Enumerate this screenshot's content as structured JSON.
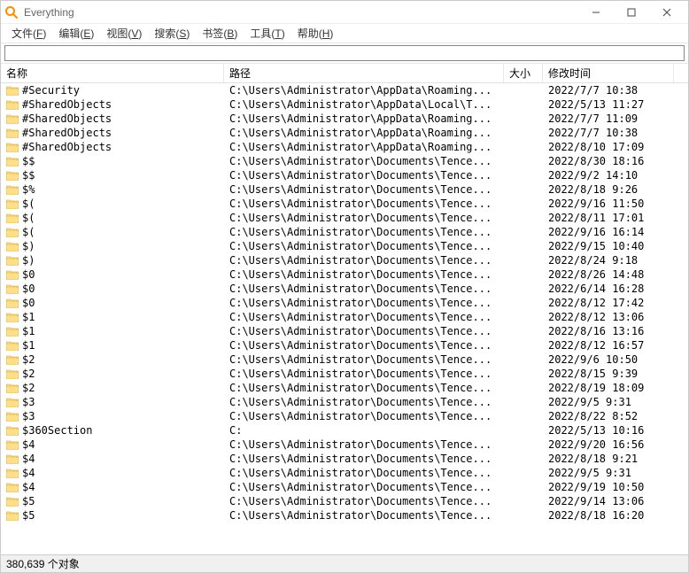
{
  "window": {
    "title": "Everything"
  },
  "menu": [
    {
      "label": "文件(F)",
      "key": "F"
    },
    {
      "label": "编辑(E)",
      "key": "E"
    },
    {
      "label": "视图(V)",
      "key": "V"
    },
    {
      "label": "搜索(S)",
      "key": "S"
    },
    {
      "label": "书签(B)",
      "key": "B"
    },
    {
      "label": "工具(T)",
      "key": "T"
    },
    {
      "label": "帮助(H)",
      "key": "H"
    }
  ],
  "search": {
    "value": "",
    "placeholder": ""
  },
  "columns": {
    "name": "名称",
    "path": "路径",
    "size": "大小",
    "modified": "修改时间"
  },
  "rows": [
    {
      "name": "#Security",
      "path": "C:\\Users\\Administrator\\AppData\\Roaming...",
      "size": "",
      "date": "2022/7/7 10:38"
    },
    {
      "name": "#SharedObjects",
      "path": "C:\\Users\\Administrator\\AppData\\Local\\T...",
      "size": "",
      "date": "2022/5/13 11:27"
    },
    {
      "name": "#SharedObjects",
      "path": "C:\\Users\\Administrator\\AppData\\Roaming...",
      "size": "",
      "date": "2022/7/7 11:09"
    },
    {
      "name": "#SharedObjects",
      "path": "C:\\Users\\Administrator\\AppData\\Roaming...",
      "size": "",
      "date": "2022/7/7 10:38"
    },
    {
      "name": "#SharedObjects",
      "path": "C:\\Users\\Administrator\\AppData\\Roaming...",
      "size": "",
      "date": "2022/8/10 17:09"
    },
    {
      "name": "$$",
      "path": "C:\\Users\\Administrator\\Documents\\Tence...",
      "size": "",
      "date": "2022/8/30 18:16"
    },
    {
      "name": "$$",
      "path": "C:\\Users\\Administrator\\Documents\\Tence...",
      "size": "",
      "date": "2022/9/2 14:10"
    },
    {
      "name": "$%",
      "path": "C:\\Users\\Administrator\\Documents\\Tence...",
      "size": "",
      "date": "2022/8/18 9:26"
    },
    {
      "name": "$(",
      "path": "C:\\Users\\Administrator\\Documents\\Tence...",
      "size": "",
      "date": "2022/9/16 11:50"
    },
    {
      "name": "$(",
      "path": "C:\\Users\\Administrator\\Documents\\Tence...",
      "size": "",
      "date": "2022/8/11 17:01"
    },
    {
      "name": "$(",
      "path": "C:\\Users\\Administrator\\Documents\\Tence...",
      "size": "",
      "date": "2022/9/16 16:14"
    },
    {
      "name": "$)",
      "path": "C:\\Users\\Administrator\\Documents\\Tence...",
      "size": "",
      "date": "2022/9/15 10:40"
    },
    {
      "name": "$)",
      "path": "C:\\Users\\Administrator\\Documents\\Tence...",
      "size": "",
      "date": "2022/8/24 9:18"
    },
    {
      "name": "$0",
      "path": "C:\\Users\\Administrator\\Documents\\Tence...",
      "size": "",
      "date": "2022/8/26 14:48"
    },
    {
      "name": "$0",
      "path": "C:\\Users\\Administrator\\Documents\\Tence...",
      "size": "",
      "date": "2022/6/14 16:28"
    },
    {
      "name": "$0",
      "path": "C:\\Users\\Administrator\\Documents\\Tence...",
      "size": "",
      "date": "2022/8/12 17:42"
    },
    {
      "name": "$1",
      "path": "C:\\Users\\Administrator\\Documents\\Tence...",
      "size": "",
      "date": "2022/8/12 13:06"
    },
    {
      "name": "$1",
      "path": "C:\\Users\\Administrator\\Documents\\Tence...",
      "size": "",
      "date": "2022/8/16 13:16"
    },
    {
      "name": "$1",
      "path": "C:\\Users\\Administrator\\Documents\\Tence...",
      "size": "",
      "date": "2022/8/12 16:57"
    },
    {
      "name": "$2",
      "path": "C:\\Users\\Administrator\\Documents\\Tence...",
      "size": "",
      "date": "2022/9/6 10:50"
    },
    {
      "name": "$2",
      "path": "C:\\Users\\Administrator\\Documents\\Tence...",
      "size": "",
      "date": "2022/8/15 9:39"
    },
    {
      "name": "$2",
      "path": "C:\\Users\\Administrator\\Documents\\Tence...",
      "size": "",
      "date": "2022/8/19 18:09"
    },
    {
      "name": "$3",
      "path": "C:\\Users\\Administrator\\Documents\\Tence...",
      "size": "",
      "date": "2022/9/5 9:31"
    },
    {
      "name": "$3",
      "path": "C:\\Users\\Administrator\\Documents\\Tence...",
      "size": "",
      "date": "2022/8/22 8:52"
    },
    {
      "name": "$360Section",
      "path": "C:",
      "size": "",
      "date": "2022/5/13 10:16"
    },
    {
      "name": "$4",
      "path": "C:\\Users\\Administrator\\Documents\\Tence...",
      "size": "",
      "date": "2022/9/20 16:56"
    },
    {
      "name": "$4",
      "path": "C:\\Users\\Administrator\\Documents\\Tence...",
      "size": "",
      "date": "2022/8/18 9:21"
    },
    {
      "name": "$4",
      "path": "C:\\Users\\Administrator\\Documents\\Tence...",
      "size": "",
      "date": "2022/9/5 9:31"
    },
    {
      "name": "$4",
      "path": "C:\\Users\\Administrator\\Documents\\Tence...",
      "size": "",
      "date": "2022/9/19 10:50"
    },
    {
      "name": "$5",
      "path": "C:\\Users\\Administrator\\Documents\\Tence...",
      "size": "",
      "date": "2022/9/14 13:06"
    },
    {
      "name": "$5",
      "path": "C:\\Users\\Administrator\\Documents\\Tence...",
      "size": "",
      "date": "2022/8/18 16:20"
    }
  ],
  "status": {
    "text": "380,639 个对象"
  }
}
